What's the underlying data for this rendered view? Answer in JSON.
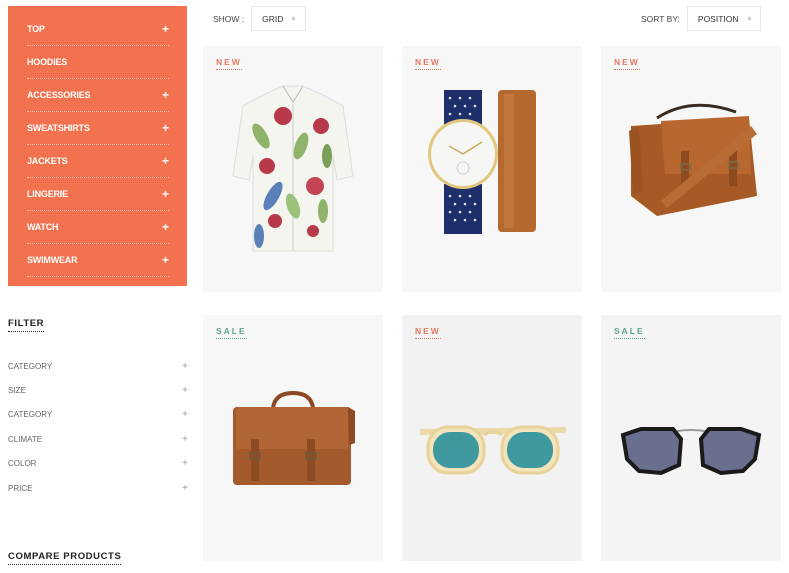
{
  "categories": [
    {
      "label": "TOP",
      "expandable": true
    },
    {
      "label": "HOODIES",
      "expandable": false
    },
    {
      "label": "ACCESSORIES",
      "expandable": true
    },
    {
      "label": "SWEATSHIRTS",
      "expandable": true
    },
    {
      "label": "JACKETS",
      "expandable": true
    },
    {
      "label": "LINGERIE",
      "expandable": true
    },
    {
      "label": "WATCH",
      "expandable": true
    },
    {
      "label": "SWIMWEAR",
      "expandable": true
    }
  ],
  "plus_glyph": "+",
  "filter": {
    "title": "FILTER",
    "items": [
      "CATEGORY",
      "SIZE",
      "CATEGORY",
      "CLIMATE",
      "COLOR",
      "PRICE"
    ]
  },
  "compare": {
    "title": "COMPARE PRODUCTS"
  },
  "toolbar": {
    "show_label": "SHOW :",
    "show_value": "GRID",
    "sort_label": "SORT BY:",
    "sort_value": "POSITION",
    "chevron": "»"
  },
  "colors": {
    "accent": "#f2724f",
    "new_badge": "#e8785e",
    "sale_badge": "#5fa787"
  },
  "products": [
    {
      "badge": "NEW",
      "badge_type": "new",
      "image": "floral-shirt"
    },
    {
      "badge": "NEW",
      "badge_type": "new",
      "image": "watch-with-leather-strap"
    },
    {
      "badge": "NEW",
      "badge_type": "new",
      "image": "leather-messenger-bag"
    },
    {
      "badge": "SALE",
      "badge_type": "sale",
      "image": "leather-briefcase"
    },
    {
      "badge": "NEW",
      "badge_type": "new",
      "image": "teal-sunglasses"
    },
    {
      "badge": "SALE",
      "badge_type": "sale",
      "image": "dark-round-sunglasses"
    }
  ]
}
